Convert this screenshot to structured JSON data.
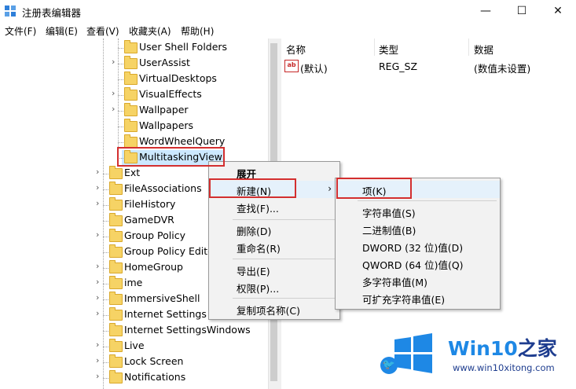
{
  "window": {
    "title": "注册表编辑器",
    "min": "—",
    "max": "☐",
    "close": "✕"
  },
  "menubar": [
    "文件(F)",
    "编辑(E)",
    "查看(V)",
    "收藏夹(A)",
    "帮助(H)"
  ],
  "tree": {
    "children_level": [
      {
        "label": "User Shell Folders",
        "expand": ""
      },
      {
        "label": "UserAssist",
        "expand": "›"
      },
      {
        "label": "VirtualDesktops",
        "expand": ""
      },
      {
        "label": "VisualEffects",
        "expand": "›"
      },
      {
        "label": "Wallpaper",
        "expand": "›"
      },
      {
        "label": "Wallpapers",
        "expand": ""
      },
      {
        "label": "WordWheelQuery",
        "expand": ""
      },
      {
        "label": "MultitaskingView",
        "expand": "",
        "selected": true
      }
    ],
    "parent_level": [
      {
        "label": "Ext",
        "expand": "›"
      },
      {
        "label": "FileAssociations",
        "expand": "›"
      },
      {
        "label": "FileHistory",
        "expand": "›"
      },
      {
        "label": "GameDVR",
        "expand": ""
      },
      {
        "label": "Group Policy",
        "expand": "›"
      },
      {
        "label": "Group Policy Editor",
        "expand": ""
      },
      {
        "label": "HomeGroup",
        "expand": "›"
      },
      {
        "label": "ime",
        "expand": "›"
      },
      {
        "label": "ImmersiveShell",
        "expand": "›"
      },
      {
        "label": "Internet Settings",
        "expand": "›"
      },
      {
        "label": "Internet SettingsWindows",
        "expand": ""
      },
      {
        "label": "Live",
        "expand": "›"
      },
      {
        "label": "Lock Screen",
        "expand": "›"
      },
      {
        "label": "Notifications",
        "expand": "›"
      }
    ]
  },
  "values_pane": {
    "headers": {
      "name": "名称",
      "type": "类型",
      "data": "数据"
    },
    "rows": [
      {
        "icon": "ab",
        "name": "(默认)",
        "type": "REG_SZ",
        "data": "(数值未设置)"
      }
    ]
  },
  "context_menu": {
    "items": [
      "展开",
      "新建(N)",
      "查找(F)...",
      "删除(D)",
      "重命名(R)",
      "导出(E)",
      "权限(P)...",
      "复制项名称(C)"
    ],
    "submenu_arrow": "›"
  },
  "submenu": {
    "items": [
      "项(K)",
      "字符串值(S)",
      "二进制值(B)",
      "DWORD (32 位)值(D)",
      "QWORD (64 位)值(Q)",
      "多字符串值(M)",
      "可扩充字符串值(E)"
    ]
  },
  "watermark": {
    "brand_a": "Win10",
    "brand_b": "之家",
    "url": "www.win10xitong.com",
    "bird": "🐦"
  },
  "colors": {
    "selection": "#cce8ff",
    "highlight_box": "#d32f2f",
    "folder": "#f6d365",
    "brand_blue": "#1e88e5"
  }
}
